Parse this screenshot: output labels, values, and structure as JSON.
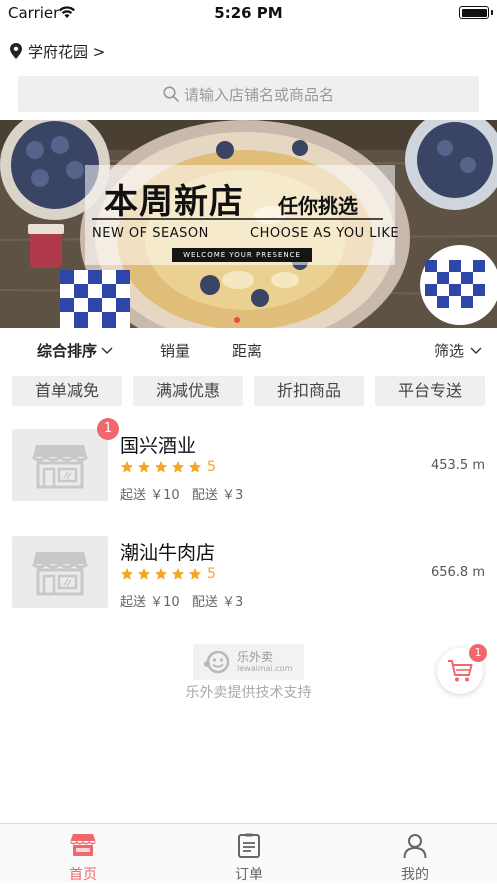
{
  "status_bar": {
    "carrier": "Carrier",
    "time": "5:26 PM"
  },
  "location": {
    "label": "学府花园 >"
  },
  "search": {
    "placeholder": "请输入店铺名或商品名"
  },
  "banner": {
    "title": "本周新店",
    "subtitle": "任你挑选",
    "en_left": "NEW  OF  SEASON",
    "en_right": "CHOOSE AS YOU LIKE",
    "welcome": "WELCOME YOUR PRESENCE",
    "page_count": 1,
    "active_page": 1
  },
  "sort_bar": {
    "comprehensive": "综合排序",
    "sales": "销量",
    "distance": "距离",
    "filter": "筛选"
  },
  "filter_tags": [
    "首单减免",
    "满减优惠",
    "折扣商品",
    "平台专送"
  ],
  "stores": [
    {
      "name": "国兴酒业",
      "badge": "1",
      "rating": "5",
      "stars": 5,
      "min_order": "起送 ￥10",
      "delivery_fee": "配送 ￥3",
      "distance": "453.5 m"
    },
    {
      "name": "潮汕牛肉店",
      "rating": "5",
      "stars": 5,
      "min_order": "起送 ￥10",
      "delivery_fee": "配送 ￥3",
      "distance": "656.8 m"
    }
  ],
  "footer": {
    "brand_name": "乐外卖",
    "brand_domain": "lewaimai.com",
    "powered_by": "乐外卖提供技术支持"
  },
  "cart": {
    "badge": "1"
  },
  "tab_bar": {
    "tabs": [
      {
        "label": "首页",
        "icon": "store-icon",
        "active": true
      },
      {
        "label": "订单",
        "icon": "order-list-icon",
        "active": false
      },
      {
        "label": "我的",
        "icon": "profile-icon",
        "active": false
      }
    ]
  },
  "colors": {
    "accent": "#f0686b",
    "star": "#f5a623",
    "tag_bg": "#efefef"
  }
}
